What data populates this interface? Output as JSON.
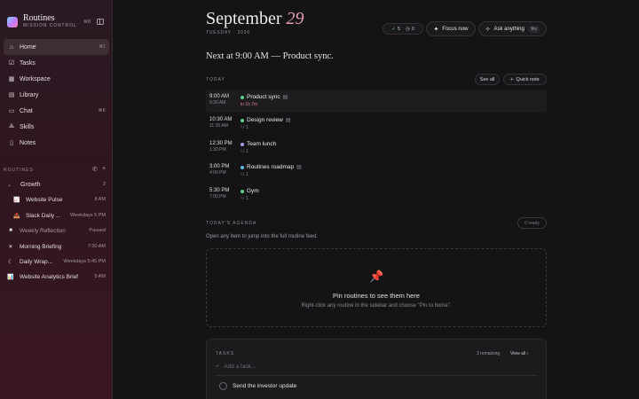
{
  "brand": {
    "title": "Routines",
    "subtitle": "MISSION CONTROL",
    "shortcut": "⌘B"
  },
  "nav": [
    {
      "label": "Home",
      "icon": "home-icon",
      "glyph": "⌂",
      "shortcut": "⌘1",
      "active": true
    },
    {
      "label": "Tasks",
      "icon": "checkbox-icon",
      "glyph": "☑",
      "shortcut": ""
    },
    {
      "label": "Workspace",
      "icon": "grid-icon",
      "glyph": "▦",
      "shortcut": ""
    },
    {
      "label": "Library",
      "icon": "book-icon",
      "glyph": "▤",
      "shortcut": ""
    },
    {
      "label": "Chat",
      "icon": "chat-icon",
      "glyph": "▭",
      "shortcut": "⌘K"
    },
    {
      "label": "Skills",
      "icon": "skills-icon",
      "glyph": "⟁",
      "shortcut": ""
    },
    {
      "label": "Notes",
      "icon": "note-icon",
      "glyph": "▯",
      "shortcut": ""
    }
  ],
  "routines_section": {
    "label": "ROUTINES",
    "group": {
      "name": "Growth",
      "count": "2"
    },
    "items": [
      {
        "name": "Website Pulse",
        "meta": "8 AM",
        "icon": "chart-icon",
        "glyph": "📈",
        "indent": true,
        "dim": false
      },
      {
        "name": "Slack Daily ...",
        "meta": "Weekdays 5 PM",
        "icon": "inbox-icon",
        "glyph": "📥",
        "indent": true,
        "dim": false
      },
      {
        "name": "Weekly Reflection",
        "meta": "Paused",
        "icon": "square-icon",
        "glyph": "■",
        "indent": false,
        "dim": true
      },
      {
        "name": "Morning Briefing",
        "meta": "7:30 AM",
        "icon": "sun-icon",
        "glyph": "☀",
        "indent": false,
        "dim": false
      },
      {
        "name": "Daily Wrap...",
        "meta": "Weekdays 5:45 PM",
        "icon": "moon-icon",
        "glyph": "☾",
        "indent": false,
        "dim": false
      },
      {
        "name": "Website Analytics Brief",
        "meta": "9 AM",
        "icon": "chart-icon",
        "glyph": "📊",
        "indent": false,
        "dim": false
      }
    ]
  },
  "header": {
    "month": "September",
    "day": "29",
    "subline": "TUESDAY · 2026",
    "stats": {
      "done": "5",
      "pending": "0"
    },
    "focus_label": "Focus now",
    "ask_label": "Ask anything",
    "ask_shortcut": "⌘K"
  },
  "next_line": "Next at 9:00 AM — Product sync.",
  "today": {
    "label": "TODAY",
    "see_all": "See all",
    "quick_note": "Quick note",
    "events": [
      {
        "start": "9:00 AM",
        "end": "9:30 AM",
        "title": "Product sync",
        "dot": "#5dcf8f",
        "sub": "in 1h 7m",
        "sub_red": true,
        "note": true,
        "highlight": true
      },
      {
        "start": "10:30 AM",
        "end": "11:15 AM",
        "title": "Design review",
        "dot": "#5dcf8f",
        "sub": "1",
        "sub_red": false,
        "note": true,
        "highlight": false
      },
      {
        "start": "12:30 PM",
        "end": "1:30 PM",
        "title": "Team lunch",
        "dot": "#a99cf2",
        "sub": "1",
        "sub_red": false,
        "note": false,
        "highlight": false
      },
      {
        "start": "3:00 PM",
        "end": "4:00 PM",
        "title": "Routines roadmap",
        "dot": "#5ab8e8",
        "sub": "1",
        "sub_red": false,
        "note": true,
        "highlight": false
      },
      {
        "start": "5:30 PM",
        "end": "7:00 PM",
        "title": "Gym",
        "dot": "#5dcf8f",
        "sub": "1",
        "sub_red": false,
        "note": false,
        "highlight": false
      }
    ]
  },
  "agenda": {
    "label": "TODAY'S AGENDA",
    "badge": "0 ready",
    "hint": "Open any item to jump into the full routine feed.",
    "pin_title": "Pin routines to see them here",
    "pin_hint": "Right-click any routine in the sidebar and choose \"Pin to home\"."
  },
  "tasks": {
    "label": "TASKS",
    "remaining": "3 remaining",
    "view_all": "View all",
    "placeholder": "Add a task...",
    "items": [
      {
        "text": "Send the investor update"
      }
    ]
  },
  "colors": {
    "accent": "#e3a0ae",
    "pin": "#e2495b",
    "green": "#5dcf8f"
  }
}
